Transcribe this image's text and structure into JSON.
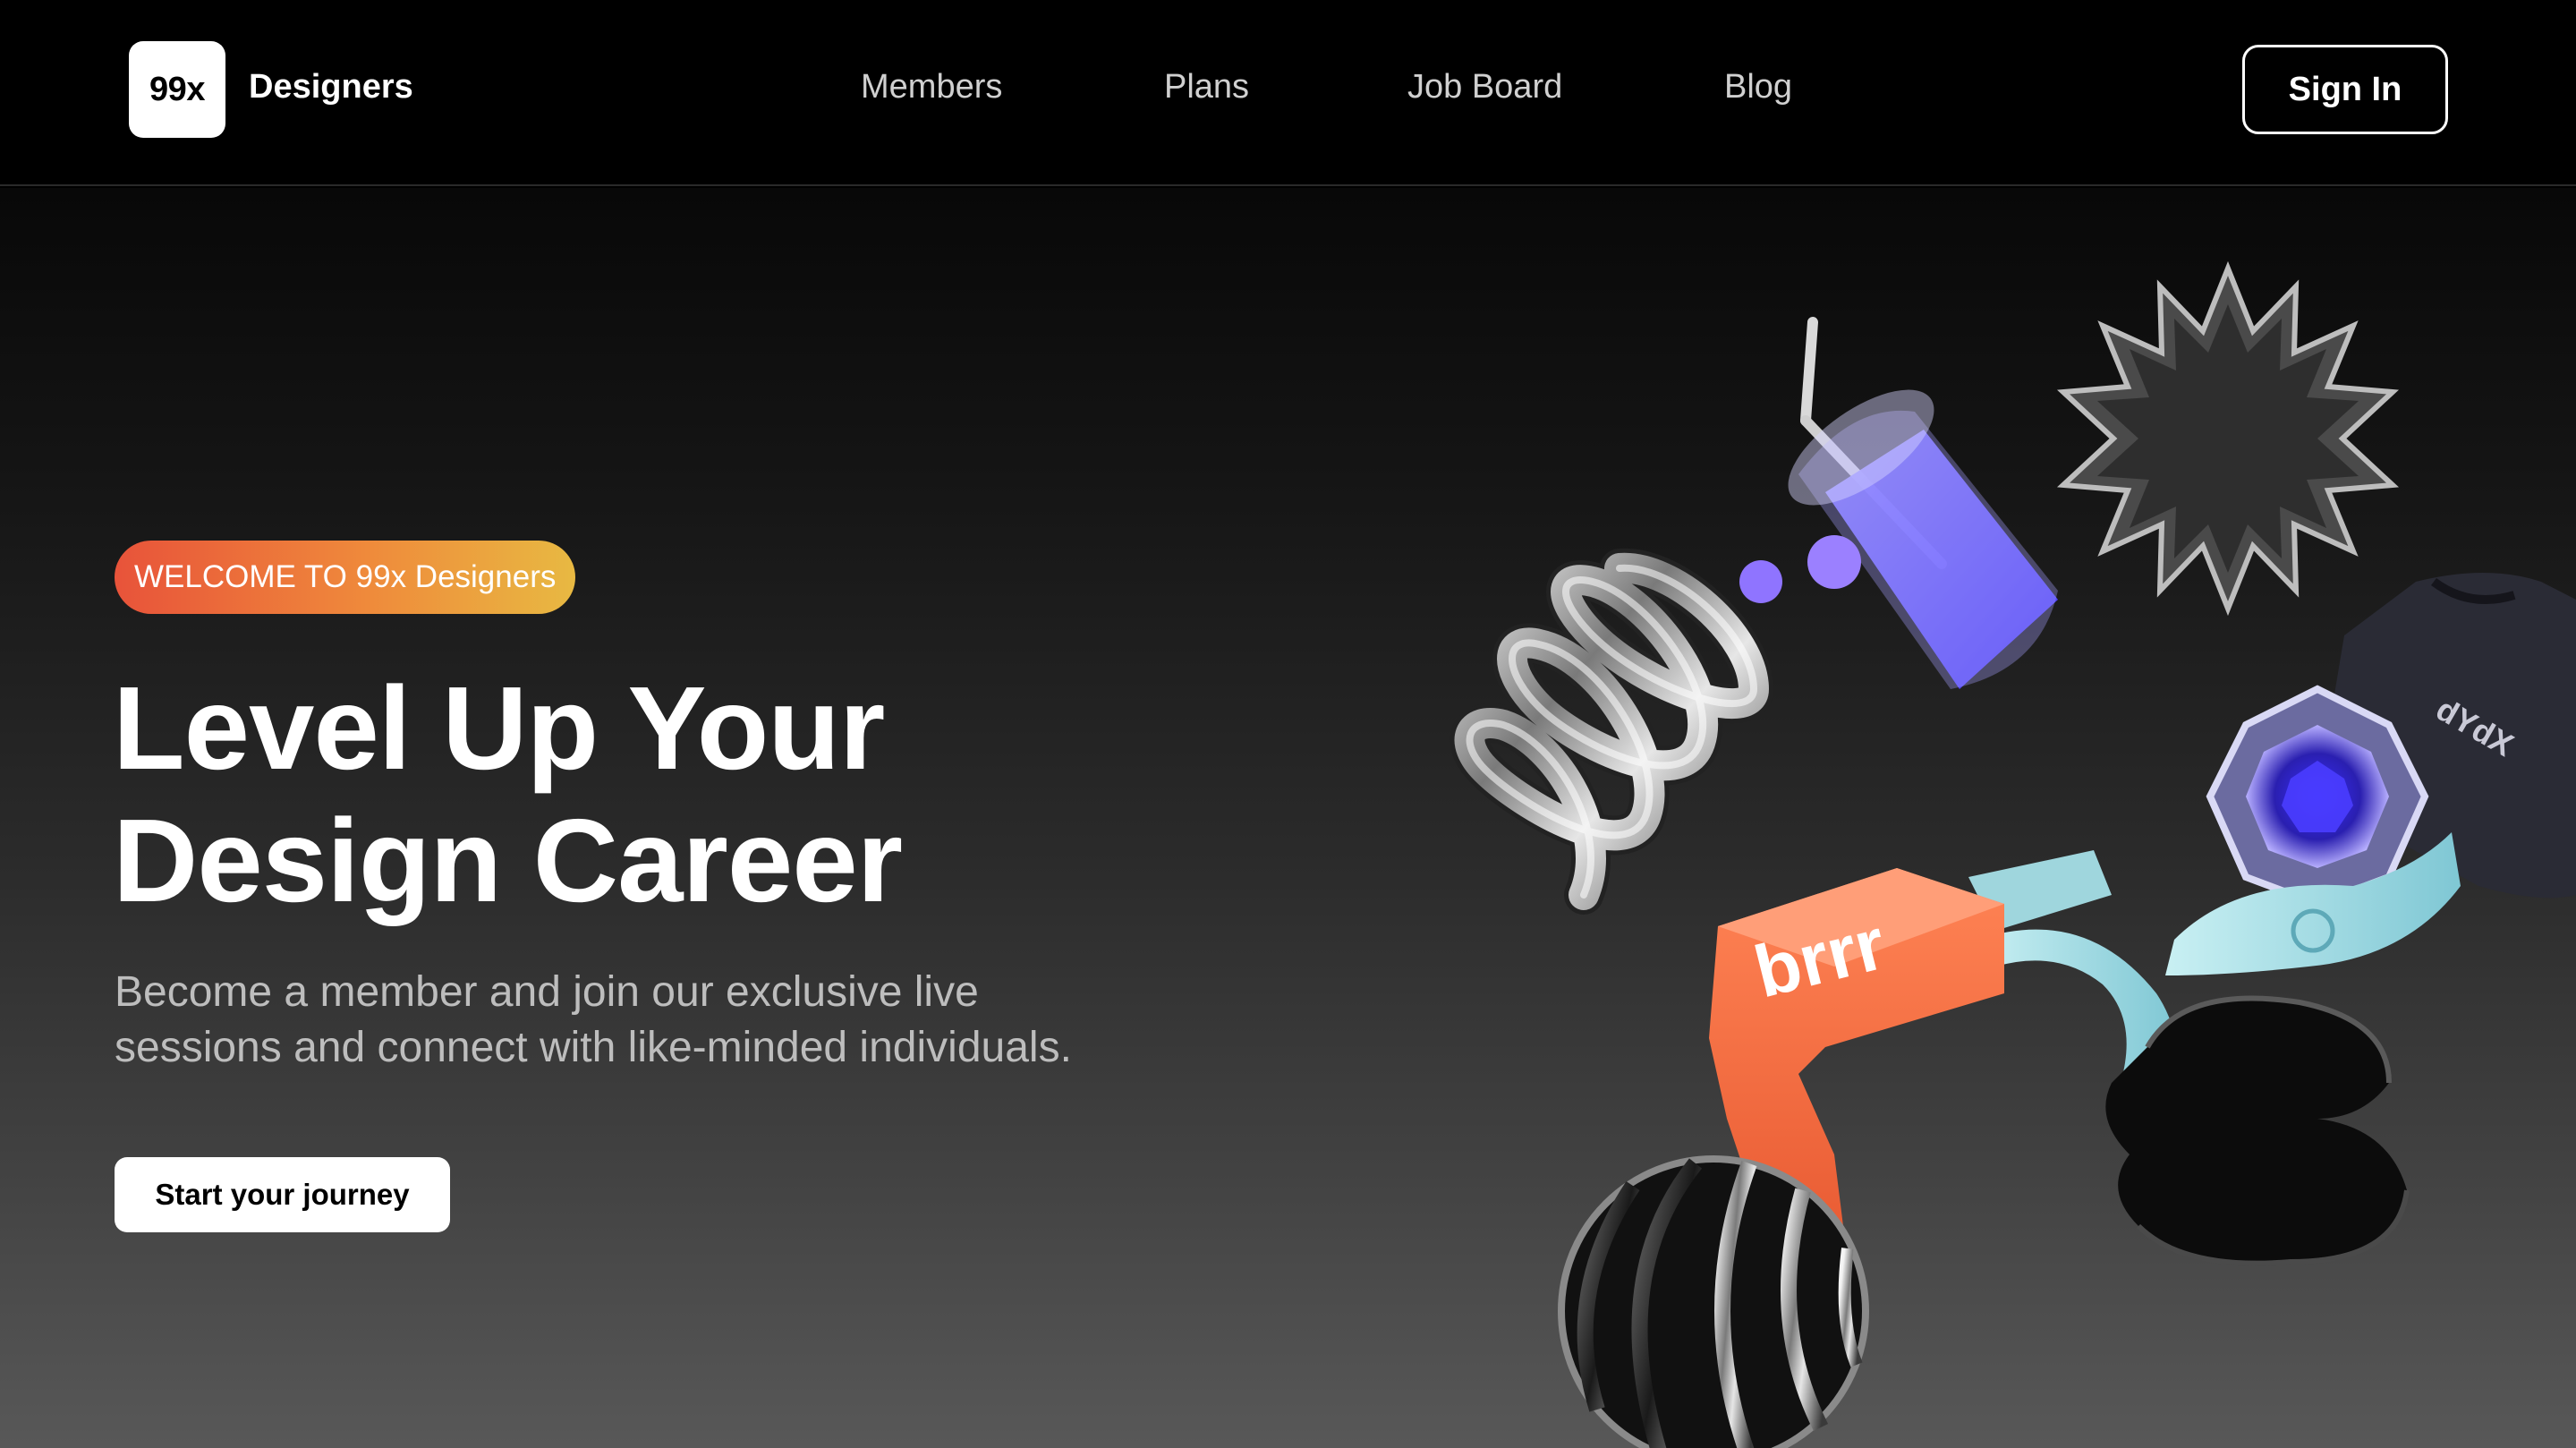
{
  "header": {
    "logo_mark": "99x",
    "logo_text": "Designers",
    "nav": [
      {
        "label": "Members"
      },
      {
        "label": "Plans"
      },
      {
        "label": "Job Board"
      },
      {
        "label": "Blog"
      }
    ],
    "signin_label": "Sign In"
  },
  "hero": {
    "badge": "WELCOME TO 99x Designers",
    "headline_line1": "Level Up Your",
    "headline_line2": "Design Career",
    "subtext_line1": "Become a member and join our exclusive live",
    "subtext_line2": "sessions and connect with like-minded individuals.",
    "cta_label": "Start your journey"
  },
  "illustration": {
    "gun_text": "brrr",
    "shirt_text": "dYdX",
    "icons": [
      "spring-coil-icon",
      "cup-with-straw-icon",
      "gear-sphere-icon",
      "t-shirt-icon",
      "crystal-badge-icon",
      "money-gun-icon",
      "banknote-icon",
      "black-blob-icon",
      "striped-ball-icon"
    ]
  },
  "colors": {
    "badge_start": "#e8533a",
    "badge_end": "#e8b942",
    "gun_orange": "#f06a3f",
    "cup_purple": "#6a5cff"
  }
}
